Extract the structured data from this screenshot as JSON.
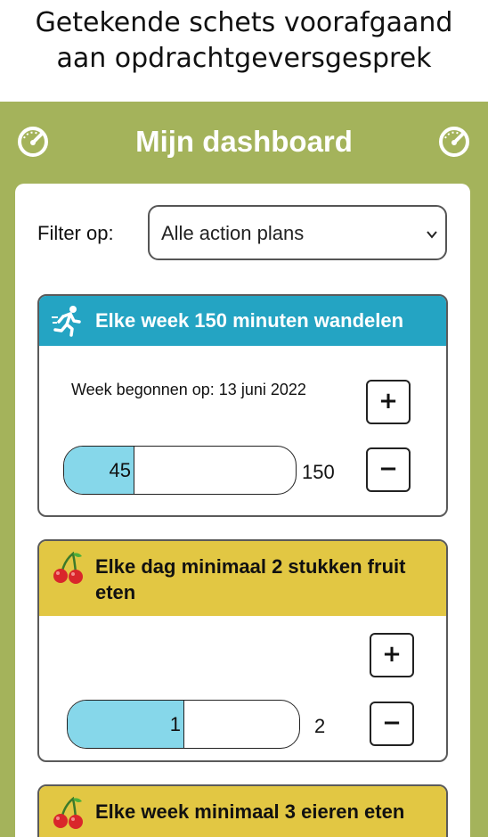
{
  "caption": {
    "line1": "Getekende schets voorafgaand",
    "line2": "aan opdrachtgeversgesprek"
  },
  "header": {
    "title": "Mijn dashboard",
    "icon": "gauge-icon",
    "background": "#a4b35b"
  },
  "filter": {
    "label": "Filter op:",
    "selected": "Alle action plans"
  },
  "plans": [
    {
      "icon": "runner-icon",
      "title": "Elke week 150 minuten wandelen",
      "header_color": "#24a4c3",
      "week_label": "Week begonnen op: 13 juni 2022",
      "progress": 45,
      "target": 150,
      "plus": "+",
      "minus": "−"
    },
    {
      "icon": "cherries-icon",
      "title": "Elke dag minimaal 2 stukken fruit eten",
      "header_color": "#e2c743",
      "week_label": "",
      "progress": 1,
      "target": 2,
      "plus": "+",
      "minus": "−"
    },
    {
      "icon": "cherries-icon",
      "title": "Elke week minimaal 3 eieren eten",
      "header_color": "#e2c743"
    }
  ],
  "colors": {
    "progress_fill": "#86d7ea"
  }
}
